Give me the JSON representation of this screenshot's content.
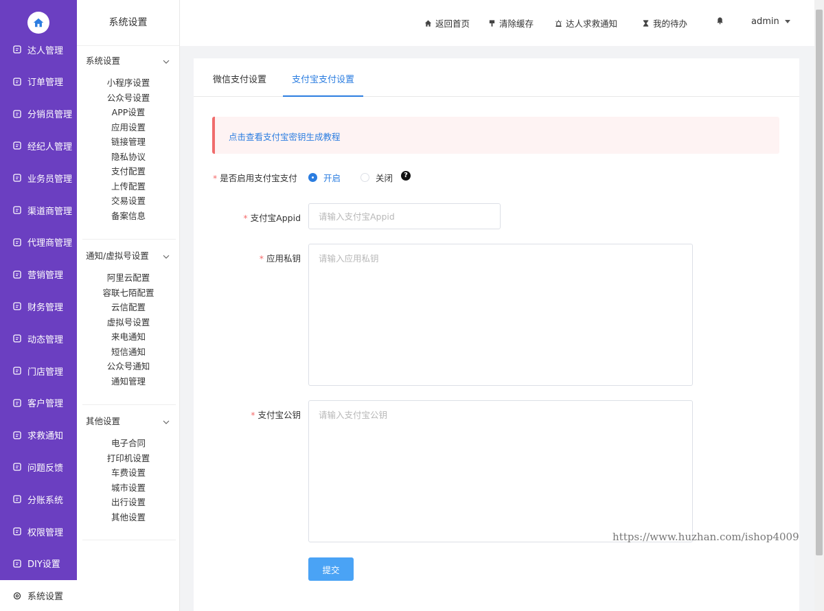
{
  "nav": {
    "items": [
      {
        "label": "达人管理",
        "icon": "talent-icon"
      },
      {
        "label": "订单管理",
        "icon": "order-icon"
      },
      {
        "label": "分销员管理",
        "icon": "distributor-icon"
      },
      {
        "label": "经纪人管理",
        "icon": "agent-icon"
      },
      {
        "label": "业务员管理",
        "icon": "salesman-icon"
      },
      {
        "label": "渠道商管理",
        "icon": "channel-icon"
      },
      {
        "label": "代理商管理",
        "icon": "proxy-icon"
      },
      {
        "label": "营销管理",
        "icon": "marketing-icon"
      },
      {
        "label": "财务管理",
        "icon": "finance-icon"
      },
      {
        "label": "动态管理",
        "icon": "compass-icon"
      },
      {
        "label": "门店管理",
        "icon": "store-icon"
      },
      {
        "label": "客户管理",
        "icon": "customer-icon"
      },
      {
        "label": "求救通知",
        "icon": "bell-icon"
      },
      {
        "label": "问题反馈",
        "icon": "feedback-icon"
      },
      {
        "label": "分账系统",
        "icon": "split-icon"
      },
      {
        "label": "权限管理",
        "icon": "permission-icon"
      },
      {
        "label": "DIY设置",
        "icon": "diy-icon"
      },
      {
        "label": "系统设置",
        "icon": "gear-icon"
      }
    ],
    "active_index": 17,
    "brand_color": "#6b3fc1"
  },
  "submenu": {
    "title": "系统设置",
    "groups": [
      {
        "title": "系统设置",
        "items": [
          "小程序设置",
          "公众号设置",
          "APP设置",
          "应用设置",
          "链接管理",
          "隐私协议",
          "支付配置",
          "上传配置",
          "交易设置",
          "备案信息"
        ]
      },
      {
        "title": "通知/虚拟号设置",
        "items": [
          "阿里云配置",
          "容联七陌配置",
          "云信配置",
          "虚拟号设置",
          "来电通知",
          "短信通知",
          "公众号通知",
          "通知管理"
        ]
      },
      {
        "title": "其他设置",
        "items": [
          "电子合同",
          "打印机设置",
          "车费设置",
          "城市设置",
          "出行设置",
          "其他设置"
        ]
      }
    ]
  },
  "header": {
    "links": [
      {
        "label": "返回首页",
        "icon": "home-icon"
      },
      {
        "label": "清除缓存",
        "icon": "brush-icon"
      },
      {
        "label": "达人求救通知",
        "icon": "alarm-icon"
      },
      {
        "label": "我的待办",
        "icon": "hourglass-icon"
      }
    ],
    "bell_icon": "bell-icon",
    "user": "admin"
  },
  "tabs": [
    {
      "label": "微信支付设置",
      "active": false
    },
    {
      "label": "支付宝支付设置",
      "active": true
    }
  ],
  "notice": {
    "text": "点击查看支付宝密钥生成教程"
  },
  "form": {
    "enable": {
      "label": "是否启用支付宝支付",
      "options": [
        "开启",
        "关闭"
      ],
      "selected": "开启",
      "help": "?"
    },
    "appid": {
      "label": "支付宝Appid",
      "placeholder": "请输入支付宝Appid",
      "value": ""
    },
    "private_key": {
      "label": "应用私钥",
      "placeholder": "请输入应用私钥",
      "value": ""
    },
    "public_key": {
      "label": "支付宝公钥",
      "placeholder": "请输入支付宝公钥",
      "value": ""
    },
    "required_mark": "*",
    "submit_label": "提交"
  },
  "watermark": "https://www.huzhan.com/ishop4009",
  "colors": {
    "accent": "#2b7de0",
    "button": "#4aa3f5",
    "required": "#f56c6c",
    "notice_bar": "#f06c6c"
  }
}
